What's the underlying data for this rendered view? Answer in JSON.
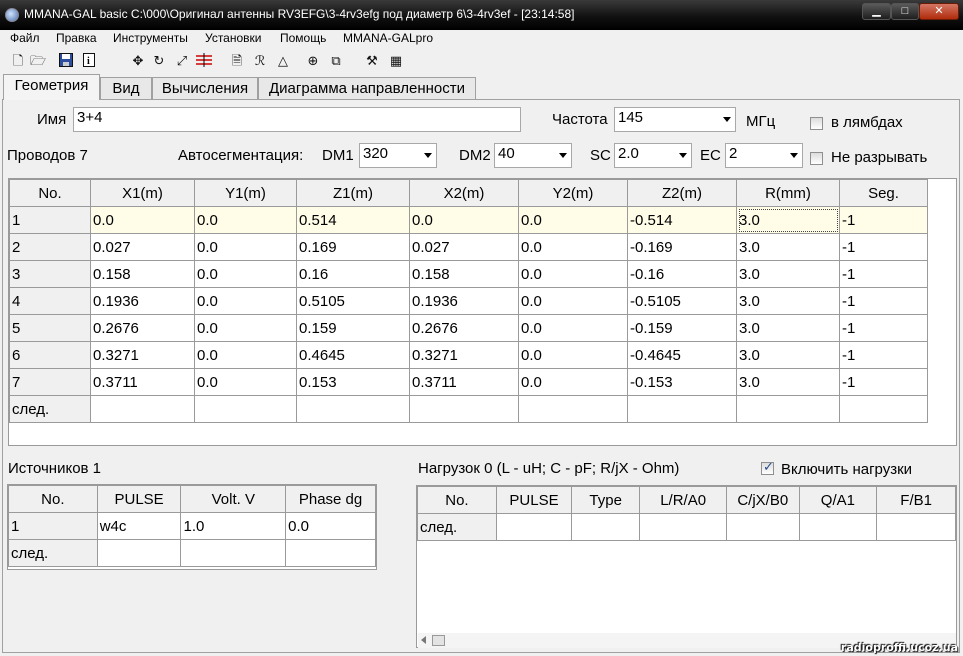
{
  "window": {
    "title": "MMANA-GAL basic  C:\\000\\Оригинал антенны RV3EFG\\3-4rv3efg под диаметр 6\\3-4rv3ef - [23:14:58]",
    "minimize": "▁",
    "maximize": "□",
    "close": "✕"
  },
  "menu": [
    "Файл",
    "Правка",
    "Инструменты",
    "Установки",
    "Помощь",
    "MMANA-GALpro"
  ],
  "toolbar_icons": [
    "new-file-icon",
    "open-folder-icon",
    "save-icon",
    "info-icon",
    "move-icon",
    "rotate-icon",
    "resize-icon",
    "wire-tool-icon",
    "sheet-icon",
    "formula-icon",
    "triangle-icon",
    "target-icon",
    "copy-icon",
    "tools-icon",
    "calculator-icon"
  ],
  "tabs": [
    "Геометрия",
    "Вид",
    "Вычисления",
    "Диаграмма направленности"
  ],
  "active_tab": 0,
  "name_label": "Имя",
  "name_value": "3+4",
  "freq_label": "Частота",
  "freq_value": "145",
  "freq_unit": "МГц",
  "lambda_label": "в лямбдах",
  "lambda_checked": false,
  "wires_label": "Проводов 7",
  "autoseg_label": "Автосегментация:",
  "dm1_label": "DM1",
  "dm1_value": "320",
  "dm2_label": "DM2",
  "dm2_value": "40",
  "sc_label": "SC",
  "sc_value": "2.0",
  "ec_label": "EC",
  "ec_value": "2",
  "nobreak_label": "Не разрывать",
  "nobreak_checked": false,
  "wires_table": {
    "headers": [
      "No.",
      "X1(m)",
      "Y1(m)",
      "Z1(m)",
      "X2(m)",
      "Y2(m)",
      "Z2(m)",
      "R(mm)",
      "Seg."
    ],
    "rows": [
      [
        "1",
        "0.0",
        "0.0",
        "0.514",
        "0.0",
        "0.0",
        "-0.514",
        "3.0",
        "-1"
      ],
      [
        "2",
        "0.027",
        "0.0",
        "0.169",
        "0.027",
        "0.0",
        "-0.169",
        "3.0",
        "-1"
      ],
      [
        "3",
        "0.158",
        "0.0",
        "0.16",
        "0.158",
        "0.0",
        "-0.16",
        "3.0",
        "-1"
      ],
      [
        "4",
        "0.1936",
        "0.0",
        "0.5105",
        "0.1936",
        "0.0",
        "-0.5105",
        "3.0",
        "-1"
      ],
      [
        "5",
        "0.2676",
        "0.0",
        "0.159",
        "0.2676",
        "0.0",
        "-0.159",
        "3.0",
        "-1"
      ],
      [
        "6",
        "0.3271",
        "0.0",
        "0.4645",
        "0.3271",
        "0.0",
        "-0.4645",
        "3.0",
        "-1"
      ],
      [
        "7",
        "0.3711",
        "0.0",
        "0.153",
        "0.3711",
        "0.0",
        "-0.153",
        "3.0",
        "-1"
      ]
    ],
    "next_label": "след."
  },
  "sources_label": "Источников 1",
  "sources_table": {
    "headers": [
      "No.",
      "PULSE",
      "Volt. V",
      "Phase dg"
    ],
    "rows": [
      [
        "1",
        "w4c",
        "1.0",
        "0.0"
      ]
    ],
    "next_label": "след."
  },
  "loads_label": "Нагрузок 0 (L - uH; C - pF; R/jX - Ohm)",
  "loads_enable_label": "Включить нагрузки",
  "loads_enable_checked": true,
  "loads_table": {
    "headers": [
      "No.",
      "PULSE",
      "Type",
      "L/R/A0",
      "C/jX/B0",
      "Q/A1",
      "F/B1"
    ],
    "next_label": "след."
  },
  "watermark": "radioproffi.ucoz.ua"
}
